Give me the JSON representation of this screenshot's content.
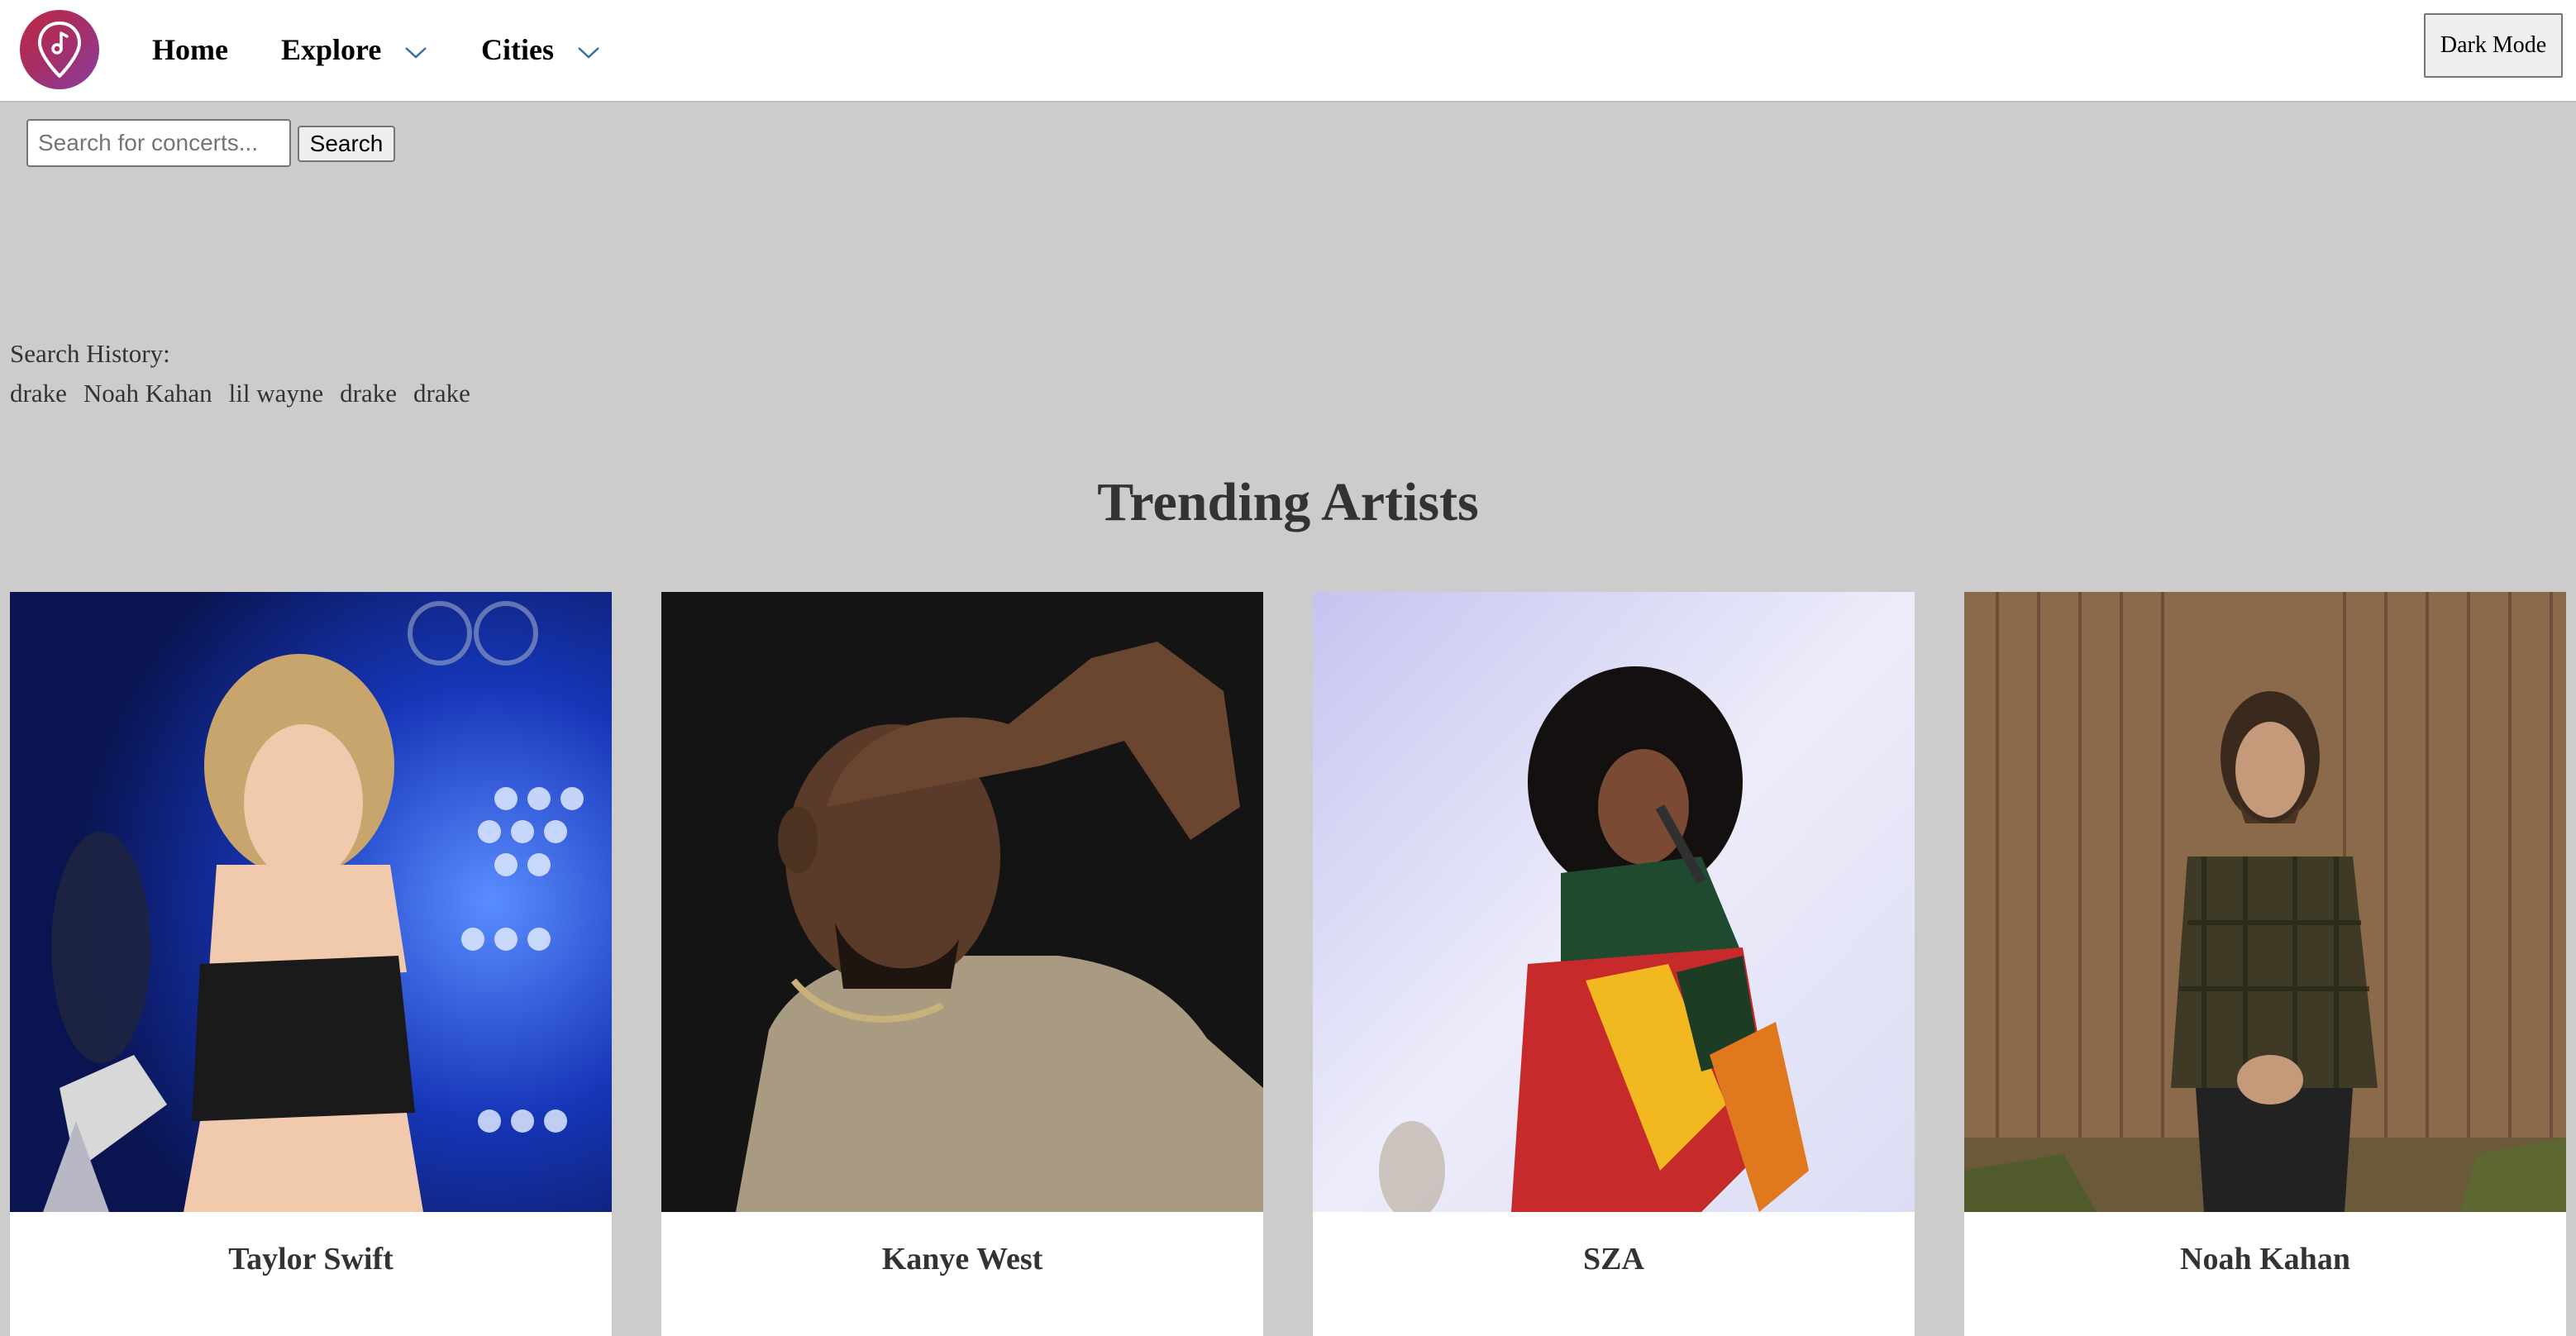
{
  "header": {
    "logo_icon": "music-pin-icon",
    "nav": {
      "home": "Home",
      "explore": "Explore",
      "cities": "Cities"
    },
    "dark_mode_label": "Dark Mode"
  },
  "search": {
    "placeholder": "Search for concerts...",
    "value": "",
    "button_label": "Search"
  },
  "history": {
    "label": "Search History:",
    "items": [
      "drake",
      "Noah Kahan",
      "lil wayne",
      "drake",
      "drake"
    ]
  },
  "trending": {
    "title": "Trending Artists",
    "artists": [
      {
        "name": "Taylor Swift"
      },
      {
        "name": "Kanye West"
      },
      {
        "name": "SZA"
      },
      {
        "name": "Noah Kahan"
      }
    ]
  },
  "colors": {
    "page_bg": "#cccccc",
    "logo_gradient_start": "#c0283f",
    "logo_gradient_end": "#8a3fa0",
    "chevron": "#3a6ea5"
  }
}
